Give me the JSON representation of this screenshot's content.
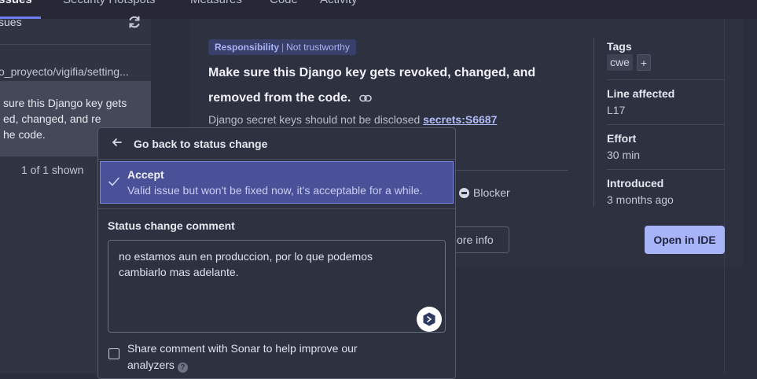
{
  "tabs": [
    {
      "label": "Issues",
      "active": true
    },
    {
      "label": "Security Hotspots",
      "active": false
    },
    {
      "label": "Measures",
      "active": false
    },
    {
      "label": "Code",
      "active": false
    },
    {
      "label": "Activity",
      "active": false
    }
  ],
  "sidebar": {
    "title": "sues",
    "path": "o_proyecto/vigifia/setting...",
    "item_text": "sure this Django key gets ed, changed, and re he code.",
    "item_lines": [
      "sure this Django key gets",
      "ed, changed, and re",
      "he code."
    ],
    "shown": "1 of 1 shown"
  },
  "issue": {
    "badge_label": "Responsibility",
    "badge_sep": "|",
    "badge_value": "Not trustworthy",
    "title": "Make sure this Django key gets revoked, changed, and removed from the code.",
    "description": "Django secret keys should not be disclosed",
    "rule": "secrets:S6687",
    "severity": "Blocker",
    "more_info": "ore info"
  },
  "meta": {
    "tags_label": "Tags",
    "tags": [
      "cwe"
    ],
    "tag_add": "+",
    "line_label": "Line affected",
    "line_value": "L17",
    "effort_label": "Effort",
    "effort_value": "30 min",
    "introduced_label": "Introduced",
    "introduced_value": "3 months ago",
    "open_ide": "Open in IDE"
  },
  "popup": {
    "back_label": "Go back to status change",
    "option_title": "Accept",
    "option_desc": "Valid issue but won't be fixed now, it's acceptable for a while.",
    "comment_label": "Status change comment",
    "comment_value": "no estamos aun en produccion, por lo que podemos\ncambiarlo mas adelante.",
    "share_text": "Share comment with Sonar to help improve our analyzers",
    "share_checked": false
  },
  "colors": {
    "accent": "#a8b4f8",
    "selected_option": "#4b5199",
    "background": "#2b2e3b"
  }
}
